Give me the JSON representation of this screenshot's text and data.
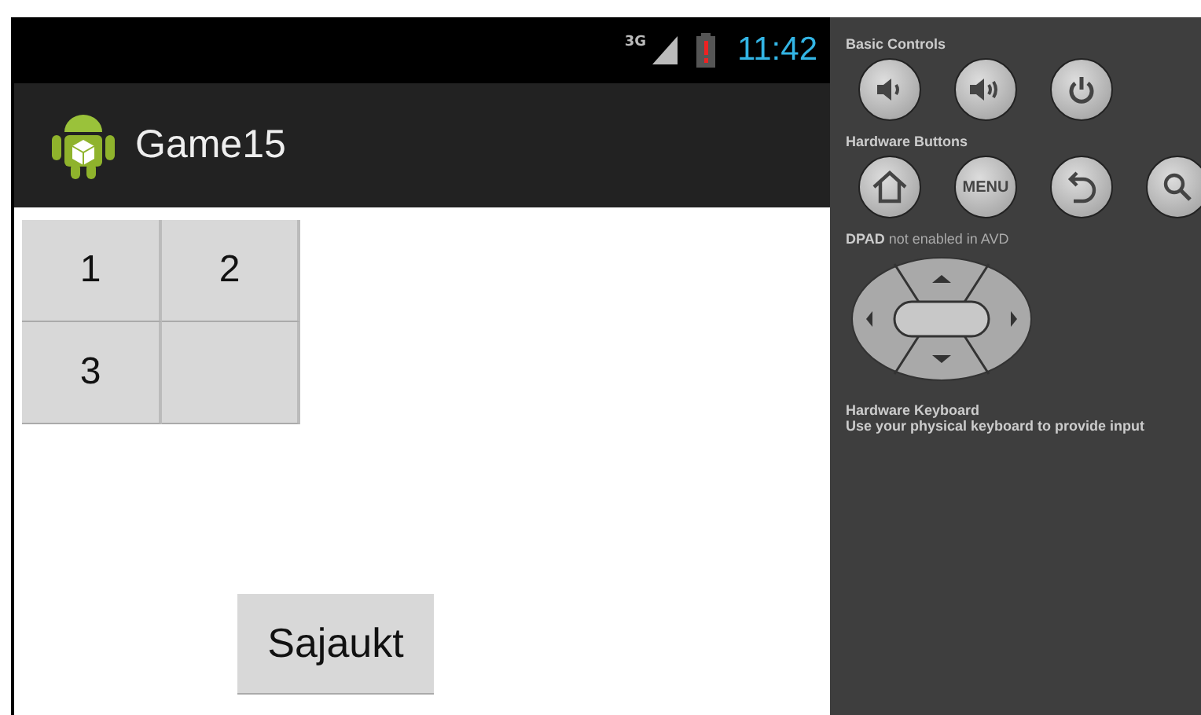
{
  "status_bar": {
    "network": "3G",
    "time": "11:42"
  },
  "action_bar": {
    "title": "Game15"
  },
  "tiles": [
    {
      "kind": "number",
      "label": "1"
    },
    {
      "kind": "number",
      "label": "2"
    },
    {
      "kind": "number",
      "label": "3"
    },
    {
      "kind": "empty"
    }
  ],
  "shuffle_button": {
    "label": "Sajaukt"
  },
  "emulator_panel": {
    "basic_controls": {
      "title": "Basic Controls"
    },
    "hardware_buttons": {
      "title": "Hardware Buttons",
      "menu_label": "MENU"
    },
    "dpad": {
      "title": "**DPAD** not enabled in AVD"
    },
    "keyboard": {
      "title": "Hardware Keyboard",
      "text": "Use your physical keyboard to provide input"
    }
  }
}
